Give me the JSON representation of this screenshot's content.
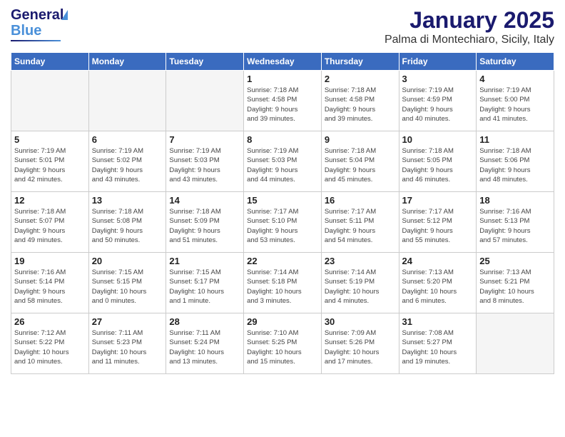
{
  "header": {
    "logo_general": "General",
    "logo_blue": "Blue",
    "title": "January 2025",
    "subtitle": "Palma di Montechiaro, Sicily, Italy"
  },
  "weekdays": [
    "Sunday",
    "Monday",
    "Tuesday",
    "Wednesday",
    "Thursday",
    "Friday",
    "Saturday"
  ],
  "weeks": [
    [
      {
        "day": "",
        "info": ""
      },
      {
        "day": "",
        "info": ""
      },
      {
        "day": "",
        "info": ""
      },
      {
        "day": "1",
        "info": "Sunrise: 7:18 AM\nSunset: 4:58 PM\nDaylight: 9 hours\nand 39 minutes."
      },
      {
        "day": "2",
        "info": "Sunrise: 7:18 AM\nSunset: 4:58 PM\nDaylight: 9 hours\nand 39 minutes."
      },
      {
        "day": "3",
        "info": "Sunrise: 7:19 AM\nSunset: 4:59 PM\nDaylight: 9 hours\nand 40 minutes."
      },
      {
        "day": "4",
        "info": "Sunrise: 7:19 AM\nSunset: 5:00 PM\nDaylight: 9 hours\nand 41 minutes."
      }
    ],
    [
      {
        "day": "5",
        "info": "Sunrise: 7:19 AM\nSunset: 5:01 PM\nDaylight: 9 hours\nand 42 minutes."
      },
      {
        "day": "6",
        "info": "Sunrise: 7:19 AM\nSunset: 5:02 PM\nDaylight: 9 hours\nand 43 minutes."
      },
      {
        "day": "7",
        "info": "Sunrise: 7:19 AM\nSunset: 5:03 PM\nDaylight: 9 hours\nand 43 minutes."
      },
      {
        "day": "8",
        "info": "Sunrise: 7:19 AM\nSunset: 5:03 PM\nDaylight: 9 hours\nand 44 minutes."
      },
      {
        "day": "9",
        "info": "Sunrise: 7:18 AM\nSunset: 5:04 PM\nDaylight: 9 hours\nand 45 minutes."
      },
      {
        "day": "10",
        "info": "Sunrise: 7:18 AM\nSunset: 5:05 PM\nDaylight: 9 hours\nand 46 minutes."
      },
      {
        "day": "11",
        "info": "Sunrise: 7:18 AM\nSunset: 5:06 PM\nDaylight: 9 hours\nand 48 minutes."
      }
    ],
    [
      {
        "day": "12",
        "info": "Sunrise: 7:18 AM\nSunset: 5:07 PM\nDaylight: 9 hours\nand 49 minutes."
      },
      {
        "day": "13",
        "info": "Sunrise: 7:18 AM\nSunset: 5:08 PM\nDaylight: 9 hours\nand 50 minutes."
      },
      {
        "day": "14",
        "info": "Sunrise: 7:18 AM\nSunset: 5:09 PM\nDaylight: 9 hours\nand 51 minutes."
      },
      {
        "day": "15",
        "info": "Sunrise: 7:17 AM\nSunset: 5:10 PM\nDaylight: 9 hours\nand 53 minutes."
      },
      {
        "day": "16",
        "info": "Sunrise: 7:17 AM\nSunset: 5:11 PM\nDaylight: 9 hours\nand 54 minutes."
      },
      {
        "day": "17",
        "info": "Sunrise: 7:17 AM\nSunset: 5:12 PM\nDaylight: 9 hours\nand 55 minutes."
      },
      {
        "day": "18",
        "info": "Sunrise: 7:16 AM\nSunset: 5:13 PM\nDaylight: 9 hours\nand 57 minutes."
      }
    ],
    [
      {
        "day": "19",
        "info": "Sunrise: 7:16 AM\nSunset: 5:14 PM\nDaylight: 9 hours\nand 58 minutes."
      },
      {
        "day": "20",
        "info": "Sunrise: 7:15 AM\nSunset: 5:15 PM\nDaylight: 10 hours\nand 0 minutes."
      },
      {
        "day": "21",
        "info": "Sunrise: 7:15 AM\nSunset: 5:17 PM\nDaylight: 10 hours\nand 1 minute."
      },
      {
        "day": "22",
        "info": "Sunrise: 7:14 AM\nSunset: 5:18 PM\nDaylight: 10 hours\nand 3 minutes."
      },
      {
        "day": "23",
        "info": "Sunrise: 7:14 AM\nSunset: 5:19 PM\nDaylight: 10 hours\nand 4 minutes."
      },
      {
        "day": "24",
        "info": "Sunrise: 7:13 AM\nSunset: 5:20 PM\nDaylight: 10 hours\nand 6 minutes."
      },
      {
        "day": "25",
        "info": "Sunrise: 7:13 AM\nSunset: 5:21 PM\nDaylight: 10 hours\nand 8 minutes."
      }
    ],
    [
      {
        "day": "26",
        "info": "Sunrise: 7:12 AM\nSunset: 5:22 PM\nDaylight: 10 hours\nand 10 minutes."
      },
      {
        "day": "27",
        "info": "Sunrise: 7:11 AM\nSunset: 5:23 PM\nDaylight: 10 hours\nand 11 minutes."
      },
      {
        "day": "28",
        "info": "Sunrise: 7:11 AM\nSunset: 5:24 PM\nDaylight: 10 hours\nand 13 minutes."
      },
      {
        "day": "29",
        "info": "Sunrise: 7:10 AM\nSunset: 5:25 PM\nDaylight: 10 hours\nand 15 minutes."
      },
      {
        "day": "30",
        "info": "Sunrise: 7:09 AM\nSunset: 5:26 PM\nDaylight: 10 hours\nand 17 minutes."
      },
      {
        "day": "31",
        "info": "Sunrise: 7:08 AM\nSunset: 5:27 PM\nDaylight: 10 hours\nand 19 minutes."
      },
      {
        "day": "",
        "info": ""
      }
    ]
  ]
}
